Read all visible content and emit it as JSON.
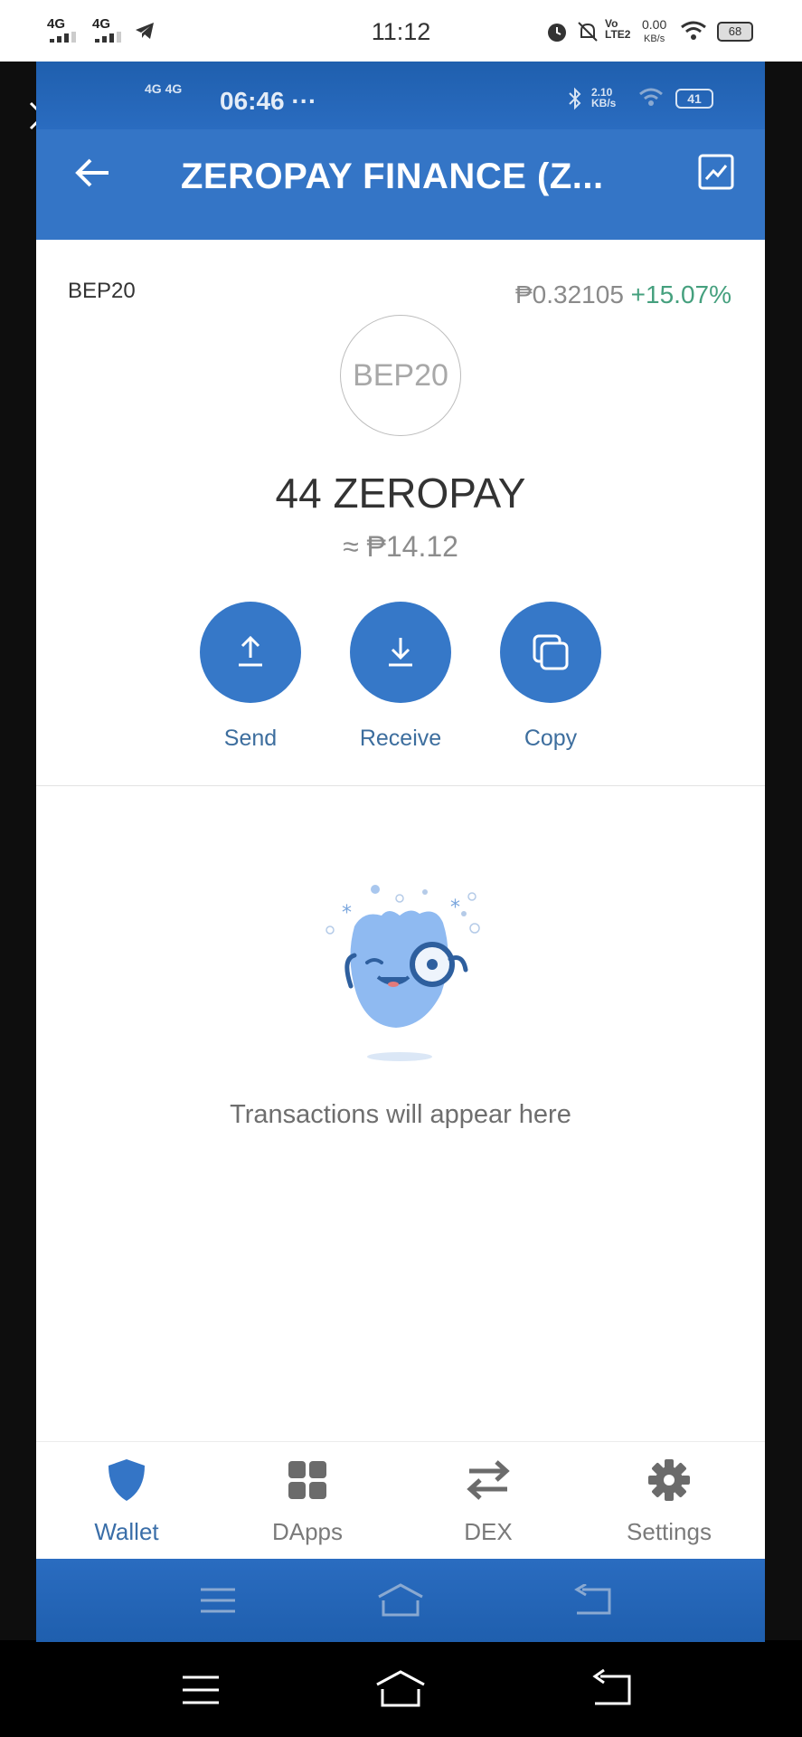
{
  "outer_status": {
    "network1": "4G",
    "network2": "4G",
    "time": "11:12",
    "lte": "LTE2",
    "speed": "0.00",
    "speed_unit": "KB/s",
    "battery": "68"
  },
  "app_status": {
    "network": "4G 4G",
    "time": "06:46 ···",
    "speed": "2.10",
    "speed_unit": "KB/s",
    "battery": "41"
  },
  "header": {
    "title": "ZEROPAY FINANCE (Z..."
  },
  "token": {
    "network_label": "BEP20",
    "price": "₱0.32105",
    "change": "+15.07%",
    "logo_text": "BEP20",
    "balance": "44 ZEROPAY",
    "fiat": "≈ ₱14.12"
  },
  "actions": [
    {
      "label": "Send"
    },
    {
      "label": "Receive"
    },
    {
      "label": "Copy"
    }
  ],
  "empty_state": {
    "text": "Transactions will appear here"
  },
  "nav": [
    {
      "label": "Wallet",
      "active": true
    },
    {
      "label": "DApps",
      "active": false
    },
    {
      "label": "DEX",
      "active": false
    },
    {
      "label": "Settings",
      "active": false
    }
  ],
  "colors": {
    "accent": "#3475c6",
    "positive": "#45a07e",
    "active_nav": "#3a6ea8"
  }
}
